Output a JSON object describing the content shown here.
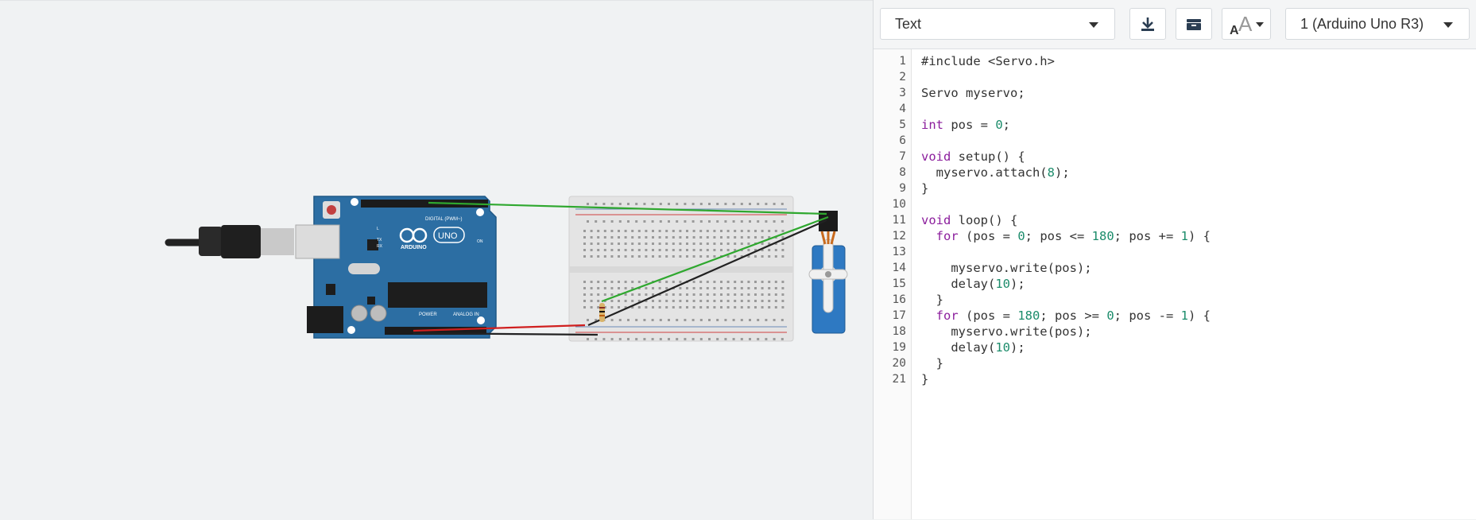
{
  "toolbar": {
    "mode_select": {
      "label": "Text"
    },
    "download_icon": "download-icon",
    "library_icon": "library-icon",
    "font_size_icon": "font-size-icon",
    "device_select": {
      "label": "1 (Arduino Uno R3)"
    }
  },
  "code": {
    "line_numbers": [
      "1",
      "2",
      "3",
      "4",
      "5",
      "6",
      "7",
      "8",
      "9",
      "10",
      "11",
      "12",
      "13",
      "14",
      "15",
      "16",
      "17",
      "18",
      "19",
      "20",
      "21"
    ],
    "lines": [
      "#include <Servo.h>",
      "",
      "Servo myservo;",
      "",
      "int pos = 0;",
      "",
      "void setup() {",
      "  myservo.attach(8);",
      "}",
      "",
      "void loop() {",
      "  for (pos = 0; pos <= 180; pos += 1) {",
      "",
      "    myservo.write(pos);",
      "    delay(10);",
      "  }",
      "  for (pos = 180; pos >= 0; pos -= 1) {",
      "    myservo.write(pos);",
      "    delay(10);",
      "  }",
      "}"
    ]
  },
  "circuit": {
    "board": {
      "brand": "ARDUINO",
      "model": "UNO",
      "digital_label": "DIGITAL (PWM~)",
      "power_label": "POWER",
      "analog_label": "ANALOG IN",
      "on_label": "ON",
      "tx_label": "TX",
      "rx_label": "RX",
      "l_label": "L"
    },
    "colors": {
      "board": "#2c6ea3",
      "wire_green": "#2fa82f",
      "wire_red": "#d0201f",
      "wire_black": "#222222",
      "servo": "#2e79c2"
    }
  }
}
